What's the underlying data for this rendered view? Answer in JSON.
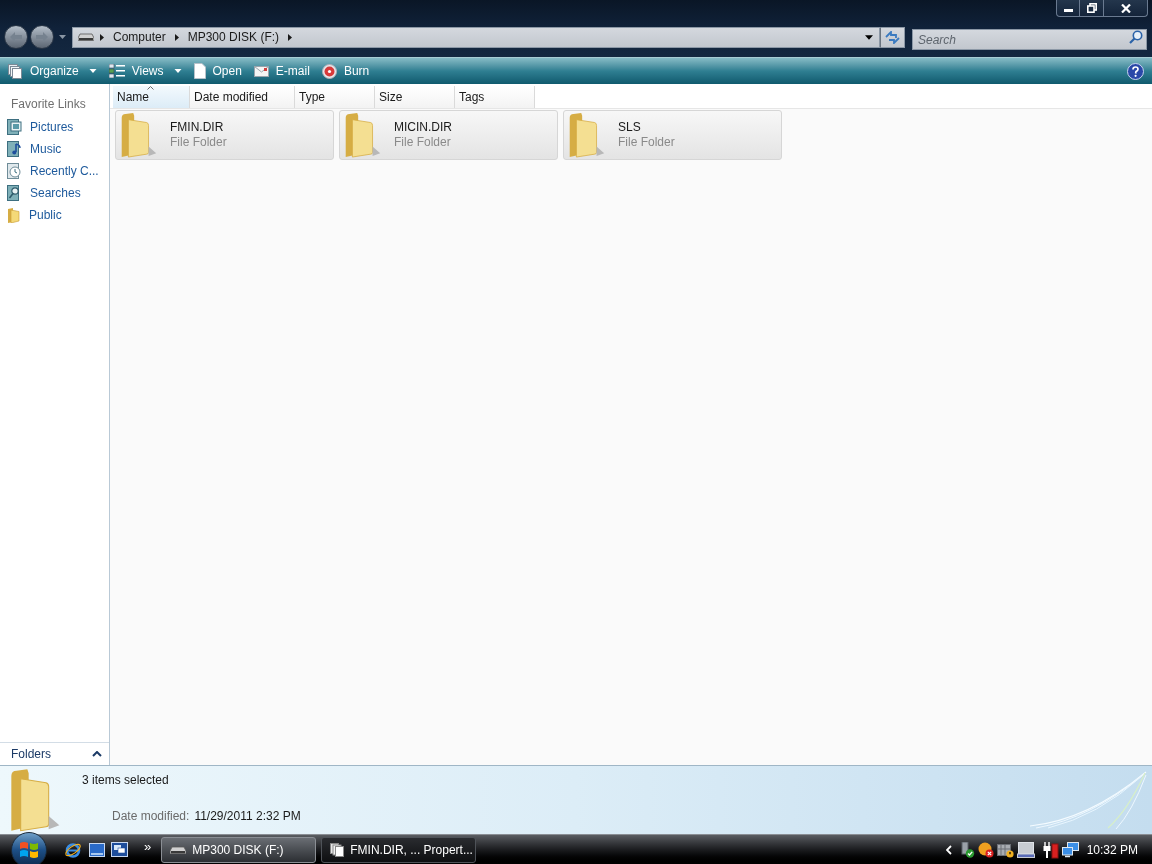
{
  "navigation": {
    "breadcrumb": [
      "Computer",
      "MP300 DISK (F:)"
    ],
    "search": {
      "placeholder": "Search"
    }
  },
  "toolbar": [
    {
      "label": "Organize",
      "kind": "menu"
    },
    {
      "label": "Views",
      "kind": "menu"
    },
    {
      "label": "Open",
      "kind": "button"
    },
    {
      "label": "E-mail",
      "kind": "button"
    },
    {
      "label": "Burn",
      "kind": "button"
    }
  ],
  "sidebar": {
    "heading": "Favorite Links",
    "items": [
      {
        "label": "Pictures"
      },
      {
        "label": "Music"
      },
      {
        "label": "Recently C..."
      },
      {
        "label": "Searches"
      },
      {
        "label": "Public"
      }
    ],
    "folders": {
      "label": "Folders",
      "expanded": false
    }
  },
  "columns": [
    {
      "label": "Name",
      "sorted": true
    },
    {
      "label": "Date modified",
      "sorted": false
    },
    {
      "label": "Type",
      "sorted": false
    },
    {
      "label": "Size",
      "sorted": false
    },
    {
      "label": "Tags",
      "sorted": false
    }
  ],
  "items": [
    {
      "name": "FMIN.DIR",
      "type": "File Folder",
      "selected": true
    },
    {
      "name": "MICIN.DIR",
      "type": "File Folder",
      "selected": true
    },
    {
      "name": "SLS",
      "type": "File Folder",
      "selected": true
    }
  ],
  "details": {
    "summary": "3 items selected",
    "property": "Date modified:",
    "value": "11/29/2011 2:32 PM"
  },
  "taskbar": {
    "overflow": "»",
    "tasks": [
      {
        "label": "MP300 DISK (F:)",
        "selected": true
      },
      {
        "label": "FMIN.DIR, ... Propert...",
        "selected": false
      }
    ],
    "clock": "10:32 PM"
  }
}
